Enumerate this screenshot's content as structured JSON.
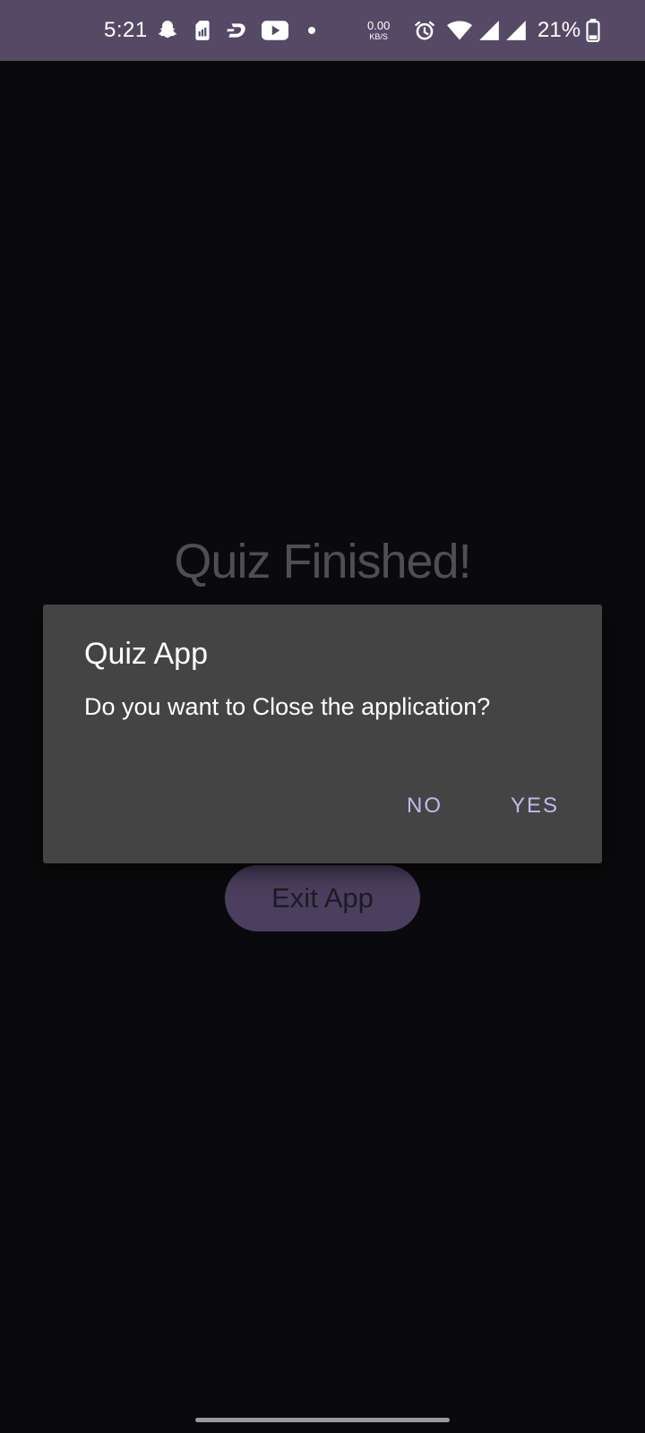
{
  "status_bar": {
    "time": "5:21",
    "net_speed_value": "0.00",
    "net_speed_unit": "KB/S",
    "battery_percent": "21%",
    "icons": [
      "snapchat-icon",
      "sim-card-icon",
      "dash-app-icon",
      "youtube-icon",
      "notification-dot-icon",
      "alarm-icon",
      "wifi-icon",
      "cell-signal-icon",
      "cell-signal-icon",
      "battery-icon"
    ],
    "color": "#544a66"
  },
  "main": {
    "title": "Quiz Finished!",
    "exit_button_label": "Exit App"
  },
  "dialog": {
    "title": "Quiz App",
    "message": "Do you want to Close the application?",
    "no_label": "NO",
    "yes_label": "YES",
    "accent_color": "#c6b8ea"
  }
}
